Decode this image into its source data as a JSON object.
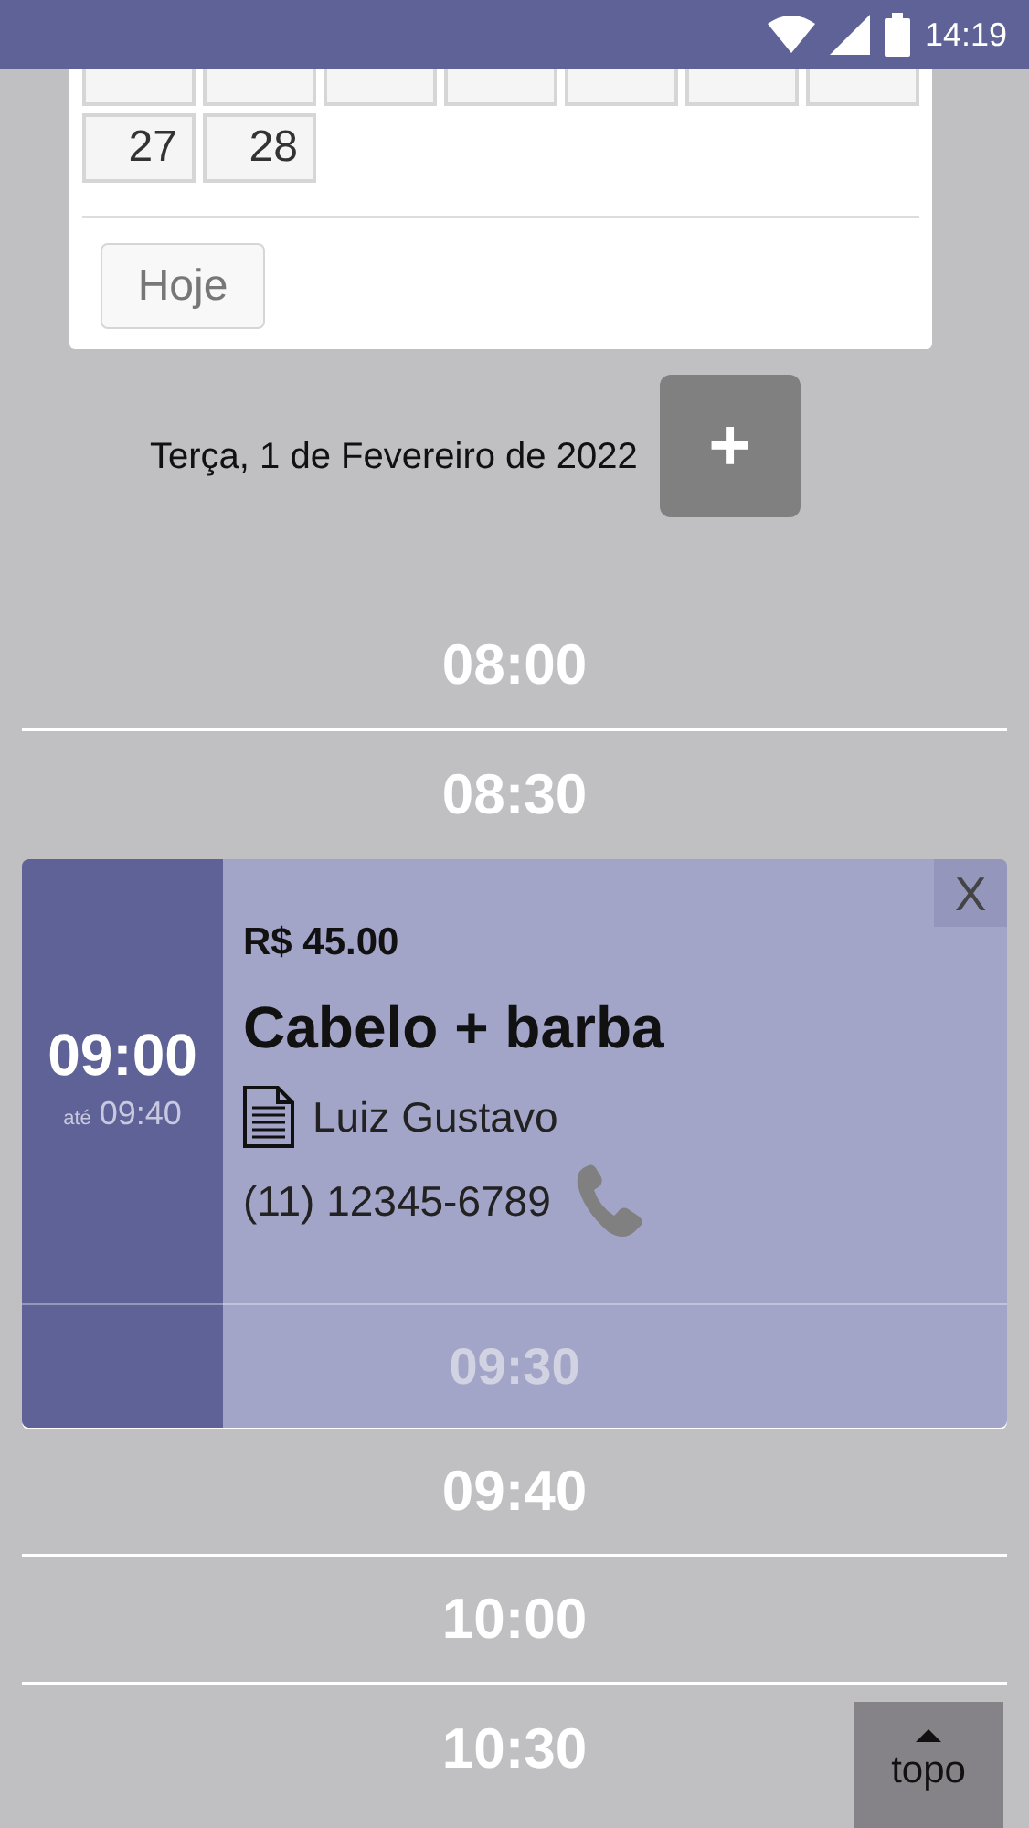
{
  "status_bar": {
    "time": "14:19"
  },
  "calendar": {
    "weeks": [
      [
        "27",
        "28"
      ]
    ],
    "today_button": "Hoje"
  },
  "date_header": {
    "label": "Terça, 1 de Fevereiro de 2022",
    "add_button": "+"
  },
  "slots": [
    {
      "kind": "slot",
      "time": "08:00"
    },
    {
      "kind": "slot",
      "time": "08:30"
    },
    {
      "kind": "appointment",
      "start": "09:00",
      "until_label": "até",
      "end": "09:40",
      "price": "R$ 45.00",
      "service": "Cabelo + barba",
      "client": "Luiz Gustavo",
      "phone": "(11) 12345-6789",
      "close_button": "X",
      "inner_slot": "09:30"
    },
    {
      "kind": "slot",
      "time": "09:40"
    },
    {
      "kind": "slot",
      "time": "10:00"
    },
    {
      "kind": "slot",
      "time": "10:30"
    }
  ],
  "topo_button": {
    "label": "topo"
  }
}
